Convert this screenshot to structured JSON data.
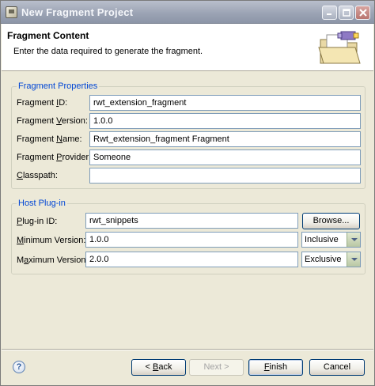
{
  "window": {
    "title": "New Fragment Project"
  },
  "header": {
    "title": "Fragment Content",
    "description": "Enter the data required to generate the fragment."
  },
  "fragment_properties": {
    "legend": "Fragment Properties",
    "fields": [
      {
        "label_before": "Fragment ",
        "label_key": "I",
        "label_after": "D:",
        "value": "rwt_extension_fragment"
      },
      {
        "label_before": "Fragment ",
        "label_key": "V",
        "label_after": "ersion:",
        "value": "1.0.0"
      },
      {
        "label_before": "Fragment ",
        "label_key": "N",
        "label_after": "ame:",
        "value": "Rwt_extension_fragment Fragment"
      },
      {
        "label_before": "Fragment ",
        "label_key": "P",
        "label_after": "rovider:",
        "value": "Someone"
      },
      {
        "label_before": "",
        "label_key": "C",
        "label_after": "lasspath:",
        "value": ""
      }
    ]
  },
  "host_plugin": {
    "legend": "Host Plug-in",
    "plugin_id": {
      "label_before": "",
      "label_key": "P",
      "label_after": "lug-in ID:",
      "value": "rwt_snippets"
    },
    "browse_label": "Browse...",
    "minimum": {
      "label_before": "",
      "label_key": "M",
      "label_after": "inimum Version:",
      "value": "1.0.0",
      "combo": "Inclusive"
    },
    "maximum": {
      "label_before": "M",
      "label_key": "a",
      "label_after": "ximum Version:",
      "value": "2.0.0",
      "combo": "Exclusive"
    }
  },
  "footer": {
    "help": "?",
    "back": {
      "before": "< ",
      "key": "B",
      "after": "ack"
    },
    "next": "Next >",
    "finish": {
      "before": "",
      "key": "F",
      "after": "inish"
    },
    "cancel": "Cancel"
  }
}
